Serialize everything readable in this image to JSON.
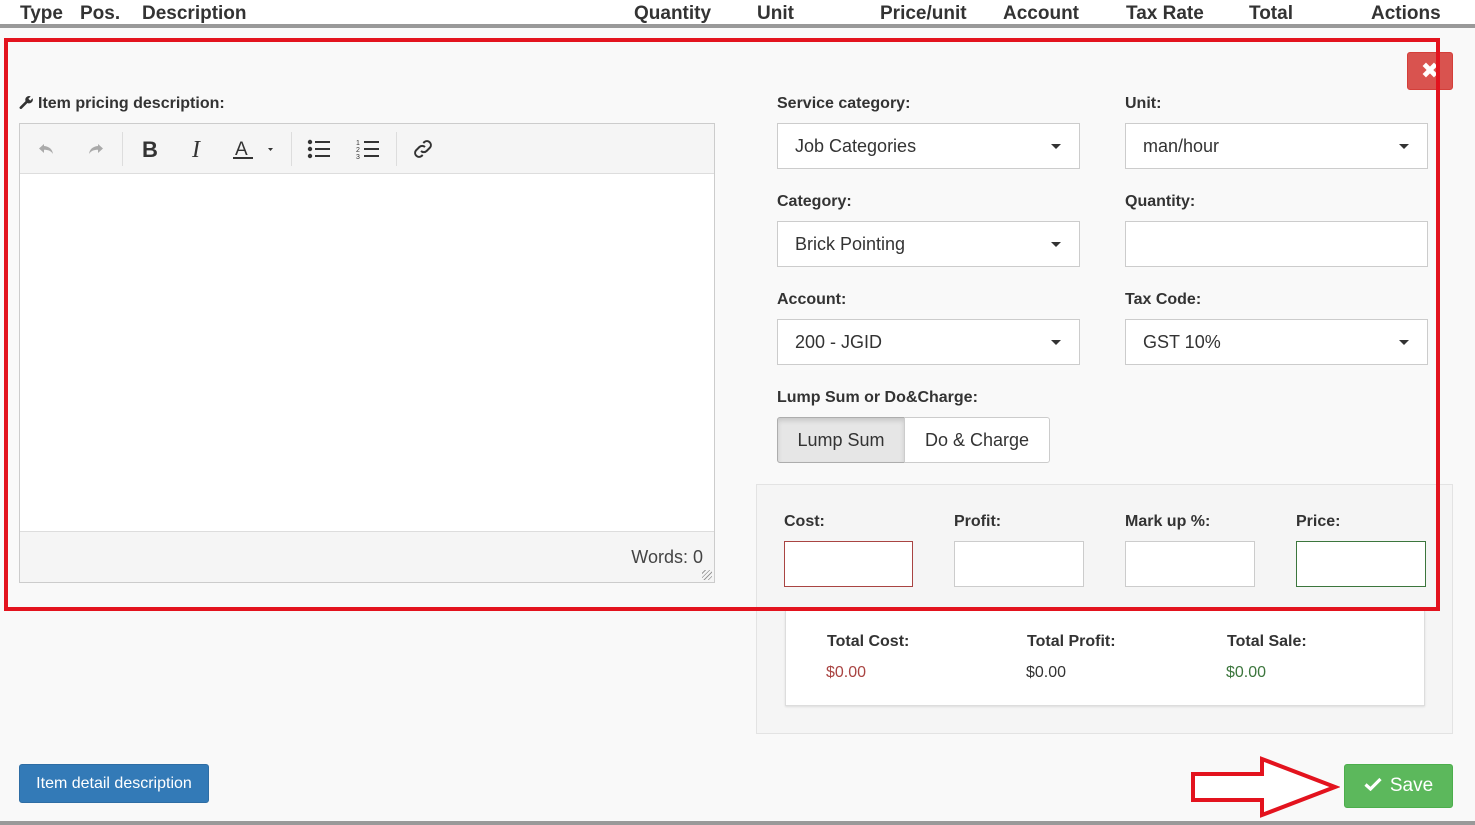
{
  "table_header": {
    "type": "Type",
    "pos": "Pos.",
    "description": "Description",
    "quantity": "Quantity",
    "unit": "Unit",
    "price_unit": "Price/unit",
    "account": "Account",
    "tax_rate": "Tax Rate",
    "total": "Total",
    "actions": "Actions"
  },
  "editor": {
    "label": "Item pricing description:",
    "word_count": "Words: 0",
    "toolbar_icons": [
      "undo-icon",
      "redo-icon",
      "bold-icon",
      "italic-icon",
      "font-color-icon",
      "bullet-list-icon",
      "numbered-list-icon",
      "link-icon"
    ]
  },
  "close_label": "✖",
  "fields": {
    "service_category_label": "Service category:",
    "service_category_value": "Job Categories",
    "unit_label": "Unit:",
    "unit_value": "man/hour",
    "category_label": "Category:",
    "category_value": "Brick Pointing",
    "quantity_label": "Quantity:",
    "quantity_value": "",
    "account_label": "Account:",
    "account_value": "200 - JGID",
    "tax_code_label": "Tax Code:",
    "tax_code_value": "GST 10%",
    "lump_label": "Lump Sum or Do&Charge:",
    "lump_sum": "Lump Sum",
    "do_charge": "Do & Charge",
    "selected_mode": "Lump Sum"
  },
  "pricing": {
    "cost_label": "Cost:",
    "profit_label": "Profit:",
    "markup_label": "Mark up %:",
    "price_label": "Price:",
    "cost_value": "",
    "profit_value": "",
    "markup_value": "",
    "price_value": ""
  },
  "totals": {
    "total_cost_label": "Total Cost:",
    "total_cost": "$0.00",
    "total_profit_label": "Total Profit:",
    "total_profit": "$0.00",
    "total_sale_label": "Total Sale:",
    "total_sale": "$0.00"
  },
  "buttons": {
    "item_detail": "Item detail description",
    "save": "Save"
  },
  "colors": {
    "highlight_red": "#e3131e",
    "cost_red": "#a94442",
    "sale_green": "#3c763d",
    "primary_blue": "#337ab7",
    "save_green": "#5cb85c",
    "danger_red": "#d9534f"
  }
}
